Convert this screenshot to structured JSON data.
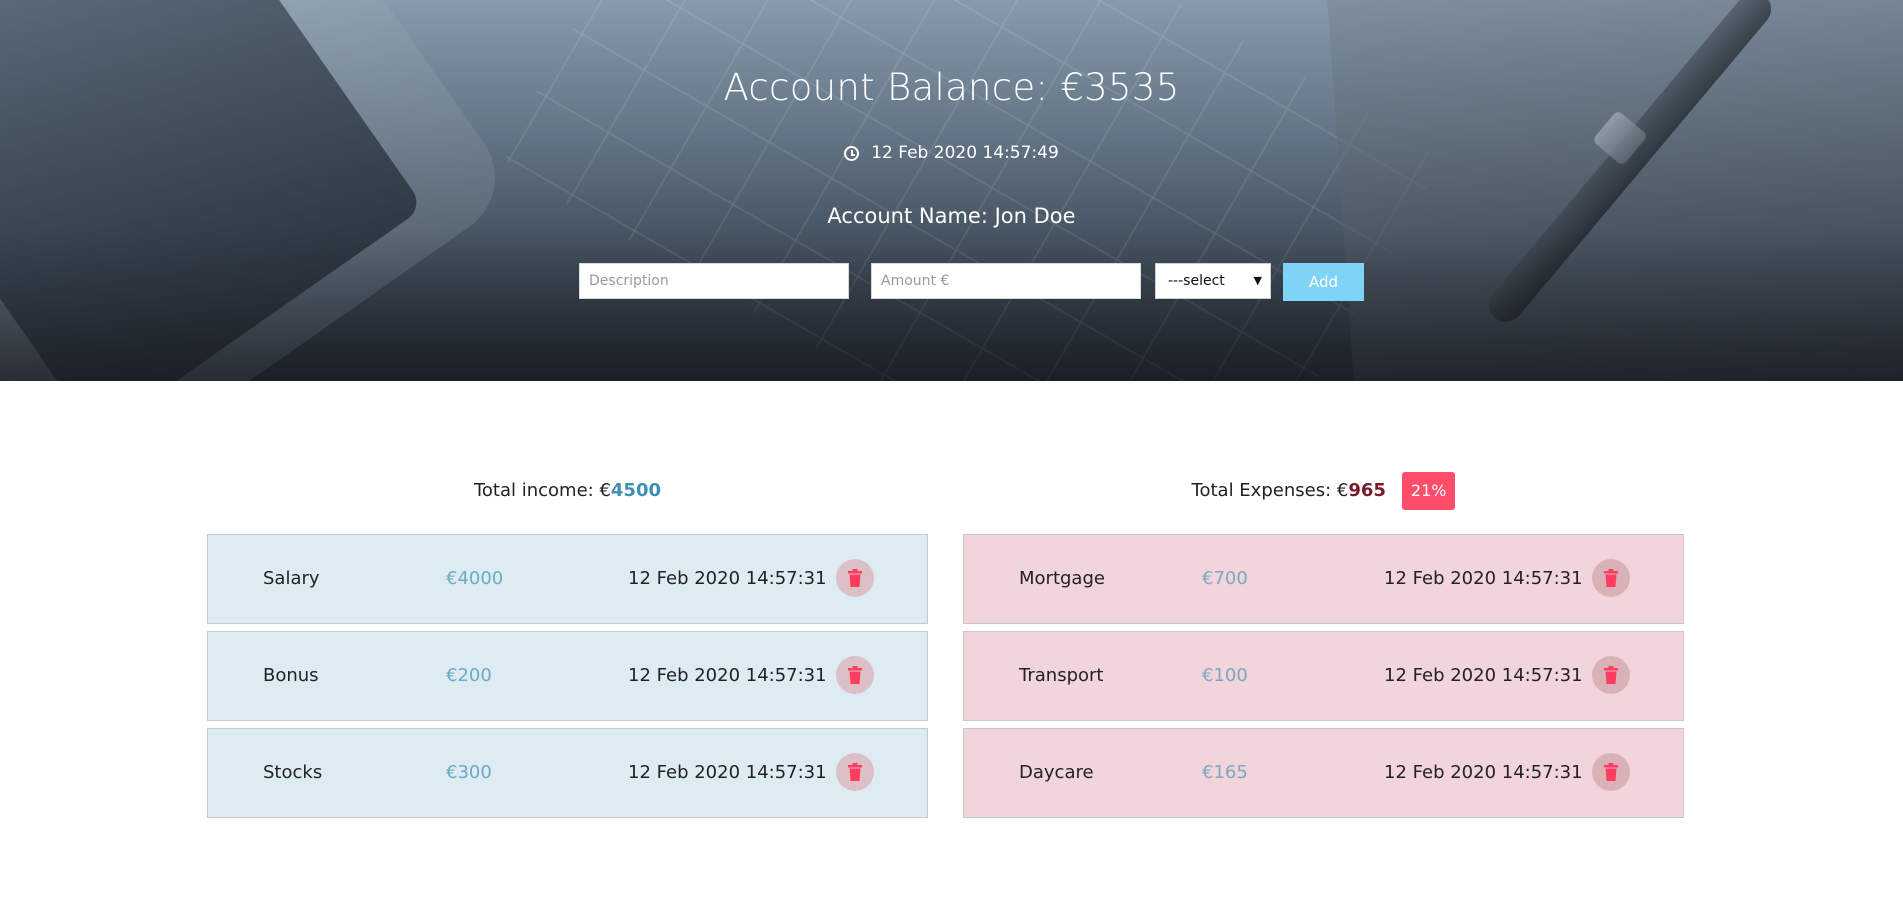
{
  "header": {
    "balance_title": "Account Balance: €3535",
    "datetime": "12 Feb 2020 14:57:49",
    "clock_icon": "clock-icon",
    "account_name": "Account Name: Jon Doe"
  },
  "form": {
    "description_placeholder": "Description",
    "amount_placeholder": "Amount €",
    "select_value": "---select",
    "add_label": "Add",
    "add_color": "#7fd3f7"
  },
  "income": {
    "total_label": "Total income: €",
    "total_value": "4500",
    "color": "#ddebf2",
    "items": [
      {
        "description": "Salary",
        "amount": "€4000",
        "date": "12 Feb 2020 14:57:31"
      },
      {
        "description": "Bonus",
        "amount": "€200",
        "date": "12 Feb 2020 14:57:31"
      },
      {
        "description": "Stocks",
        "amount": "€300",
        "date": "12 Feb 2020 14:57:31"
      }
    ]
  },
  "expenses": {
    "total_label": "Total Expenses: €",
    "total_value": "965",
    "percent": "21%",
    "percent_color": "#ff4d6a",
    "color": "#f1d5da",
    "items": [
      {
        "description": "Mortgage",
        "amount": "€700",
        "date": "12 Feb 2020 14:57:31"
      },
      {
        "description": "Transport",
        "amount": "€100",
        "date": "12 Feb 2020 14:57:31"
      },
      {
        "description": "Daycare",
        "amount": "€165",
        "date": "12 Feb 2020 14:57:31"
      }
    ]
  },
  "icons": {
    "delete": "trash-icon",
    "select_caret": "caret-down-icon"
  }
}
